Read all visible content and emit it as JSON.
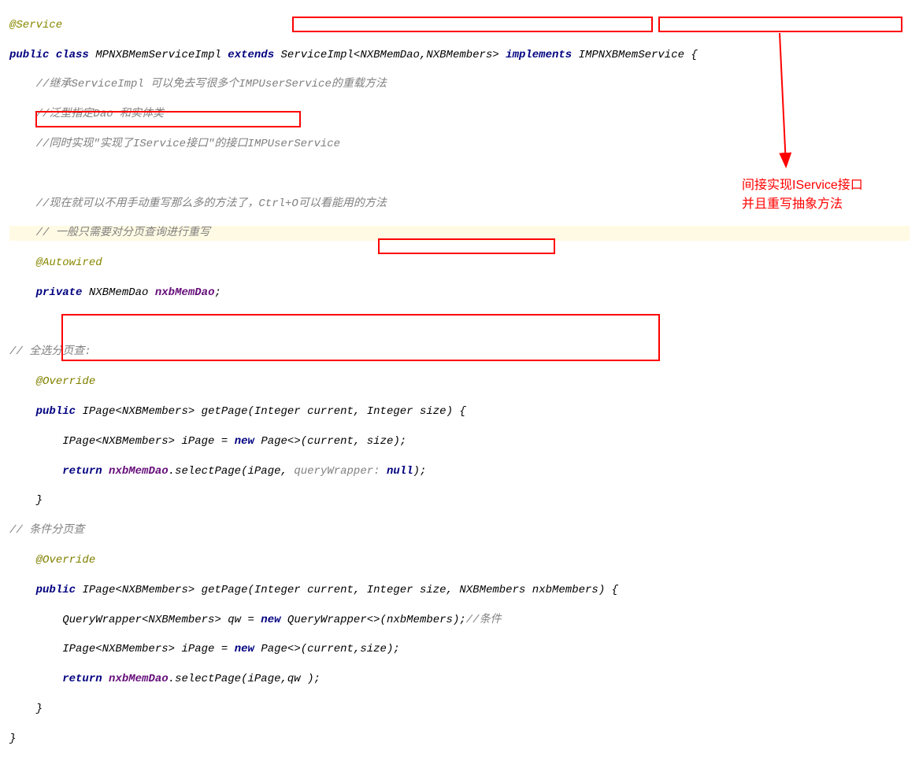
{
  "code": {
    "annotation_service": "@Service",
    "public": "public",
    "class_kw": "class",
    "class_name": "MPNXBMemServiceImpl",
    "extends_kw": "extends",
    "extends_type": "ServiceImpl<NXBMemDao,NXBMembers>",
    "implements_kw": "implements",
    "implements_type": "IMPNXBMemService",
    "brace_open": "{",
    "comment1": "//继承ServiceImpl 可以免去写很多个IMPUserService的重载方法",
    "comment2": "//泛型指定Dao 和实体类",
    "comment3": "//同时实现\"实现了IService接口\"的接口IMPUserService",
    "comment4": "//现在就可以不用手动重写那么多的方法了，Ctrl+O可以看能用的方法",
    "comment5": "// 一般只需要对分页查询进行重写",
    "autowired": "@Autowired",
    "private_kw": "private",
    "dao_type": "NXBMemDao",
    "dao_field": "nxbMemDao",
    "semi": ";",
    "region1": "// 全选分页查:",
    "override": "@Override",
    "ipage_ret": "IPage<NXBMembers>",
    "getpage": "getPage",
    "int_type": "Integer",
    "p_current": "current",
    "p_size": "size",
    "ipage_decl": "IPage<NXBMembers>",
    "ipage_var": "iPage",
    "eq": "=",
    "new_kw": "new",
    "page_ctor": "Page<>",
    "paren": "(",
    "cparen": ")",
    "comma": ", ",
    "return_kw": "return",
    "selectPage": ".selectPage(iPage, ",
    "qw_hint": "queryWrapper:",
    "null_kw": "null",
    "close_call": ");",
    "region2": "// 条件分页查",
    "nxbmembers_type": "NXBMembers",
    "p_nxbmembers": "nxbMembers",
    "qw_decl": "QueryWrapper<NXBMembers>",
    "qw_var": "qw",
    "qw_ctor": "QueryWrapper<>",
    "qw_arg": "(nxbMembers);",
    "qw_comment": "//条件",
    "page_args2": "(current,size);",
    "selectPage2": ".selectPage(iPage,qw );",
    "brace_close": "}"
  },
  "annotation": {
    "line1": "间接实现IService接口",
    "line2": "并且重写抽象方法"
  }
}
